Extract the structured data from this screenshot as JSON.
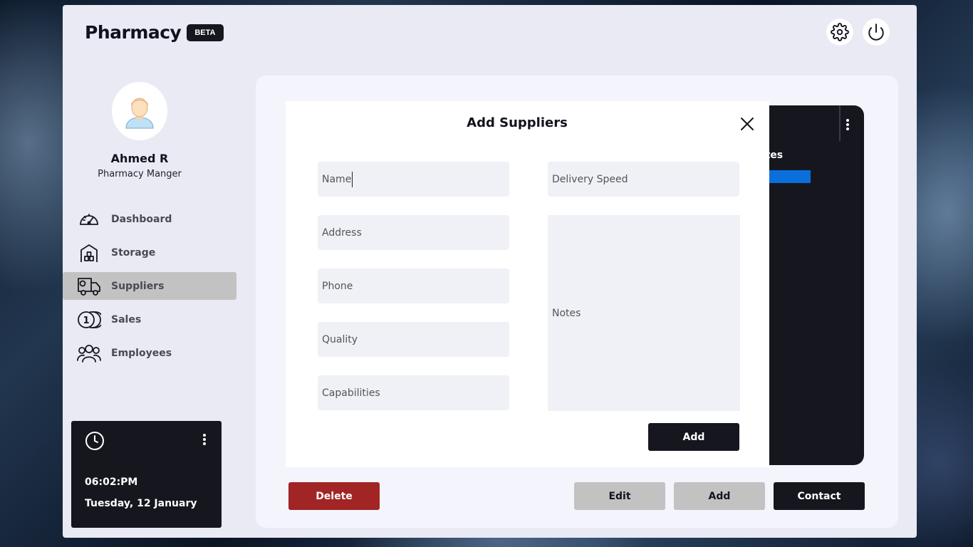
{
  "app": {
    "title": "Pharmacy",
    "badge": "BETA"
  },
  "header": {
    "settings_icon": "gear-icon",
    "power_icon": "power-icon"
  },
  "user": {
    "name": "Ahmed R",
    "role": "Pharmacy Manger",
    "avatar_icon": "user-avatar-icon"
  },
  "nav": {
    "items": [
      {
        "label": "Dashboard",
        "icon": "speedometer-icon",
        "active": false
      },
      {
        "label": "Storage",
        "icon": "warehouse-icon",
        "active": false
      },
      {
        "label": "Suppliers",
        "icon": "delivery-truck-icon",
        "active": true
      },
      {
        "label": "Sales",
        "icon": "coins-icon",
        "active": false
      },
      {
        "label": "Employees",
        "icon": "people-icon",
        "active": false
      }
    ]
  },
  "clock": {
    "time": "06:02:PM",
    "date": "Tuesday, 12 January",
    "icon": "clock-icon",
    "menu_icon": "more-vertical-icon"
  },
  "panel": {
    "notes_header": "otes"
  },
  "actions": {
    "delete": "Delete",
    "edit": "Edit",
    "add": "Add",
    "contact": "Contact"
  },
  "modal": {
    "title": "Add Suppliers",
    "close_icon": "close-icon",
    "fields": {
      "name": "Name",
      "address": "Address",
      "phone": "Phone",
      "quality": "Quality",
      "capabilities": "Capabilities",
      "delivery_speed": "Delivery Speed",
      "notes": "Notes"
    },
    "submit": "Add"
  },
  "colors": {
    "dark": "#16161f",
    "delete": "#a12525",
    "accent_blue": "#0a6fdc",
    "active_nav": "#c2c2c2",
    "app_bg": "#e9eaf4"
  }
}
